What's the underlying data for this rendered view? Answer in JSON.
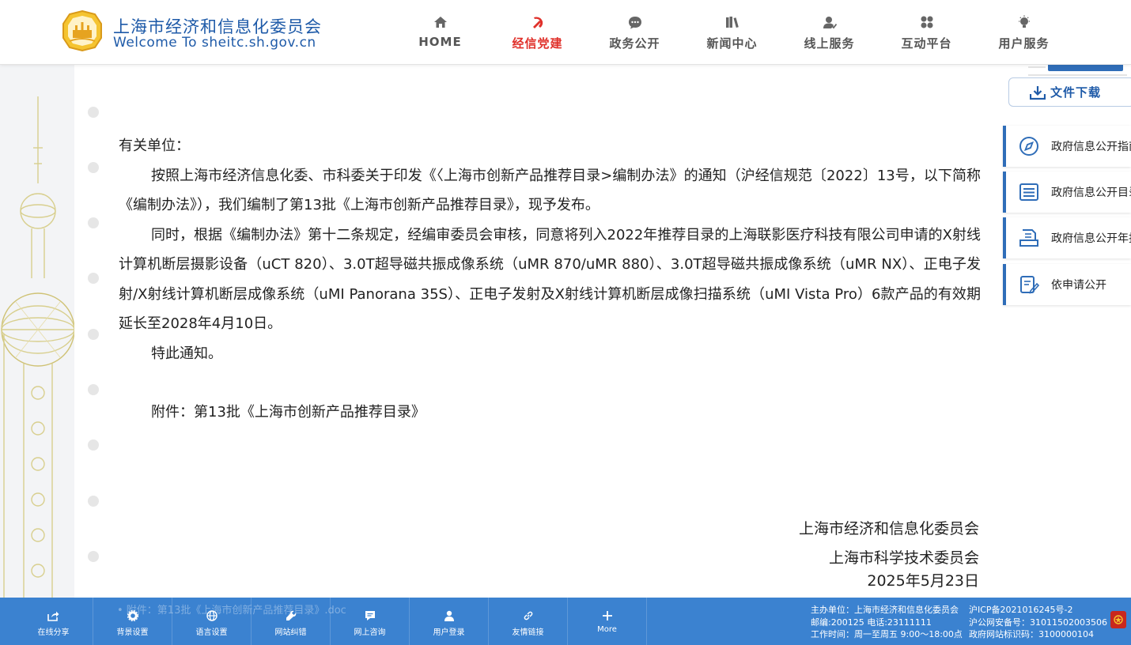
{
  "header": {
    "site_name_cn": "上海市经济和信息化委员会",
    "site_name_en": "Welcome To sheitc.sh.gov.cn",
    "nav": [
      {
        "label": "HOME",
        "icon": "home-icon",
        "active": false
      },
      {
        "label": "经信党建",
        "icon": "party-emblem-icon",
        "active": true
      },
      {
        "label": "政务公开",
        "icon": "chat-bubble-icon",
        "active": false
      },
      {
        "label": "新闻中心",
        "icon": "books-icon",
        "active": false
      },
      {
        "label": "线上服务",
        "icon": "user-service-icon",
        "active": false
      },
      {
        "label": "互动平台",
        "icon": "interaction-icon",
        "active": false
      },
      {
        "label": "用户服务",
        "icon": "lightbulb-icon",
        "active": false
      }
    ]
  },
  "article": {
    "salutation": "有关单位：",
    "paragraphs": [
      "按照上海市经济信息化委、市科委关于印发《〈上海市创新产品推荐目录>编制办法》的通知（沪经信规范〔2022〕13号，以下简称《编制办法》），我们编制了第13批《上海市创新产品推荐目录》，现予发布。",
      "同时，根据《编制办法》第十二条规定，经编审委员会审核，同意将列入2022年推荐目录的上海联影医疗科技有限公司申请的X射线计算机断层摄影设备（uCT 820）、3.0T超导磁共振成像系统（uMR 870/uMR 880）、3.0T超导磁共振成像系统（uMR NX）、正电子发射/X射线计算机断层成像系统（uMI Panorana 35S）、正电子发射及X射线计算机断层成像扫描系统（uMI Vista Pro）6款产品的有效期延长至2028年4月10日。",
      "特此通知。"
    ],
    "attachment": "附件：第13批《上海市创新产品推荐目录》",
    "signatures": [
      "上海市经济和信息化委员会",
      "上海市科学技术委员会"
    ],
    "date": "2025年5月23日"
  },
  "sidebar": {
    "download_label": "文件下载",
    "links": [
      {
        "label": "政府信息公开指南",
        "icon": "compass-icon"
      },
      {
        "label": "政府信息公开目录",
        "icon": "list-icon"
      },
      {
        "label": "政府信息公开年报",
        "icon": "report-icon"
      },
      {
        "label": "依申请公开",
        "icon": "apply-form-icon"
      }
    ]
  },
  "footer": {
    "tools": [
      {
        "label": "在线分享",
        "icon": "share-icon"
      },
      {
        "label": "背景设置",
        "icon": "gear-icon"
      },
      {
        "label": "语言设置",
        "icon": "globe-icon"
      },
      {
        "label": "网站纠错",
        "icon": "wrench-icon"
      },
      {
        "label": "网上咨询",
        "icon": "message-icon"
      },
      {
        "label": "用户登录",
        "icon": "user-icon"
      },
      {
        "label": "友情链接",
        "icon": "link-icon"
      },
      {
        "label": "More",
        "icon": "plus-icon"
      }
    ],
    "ghost_attachment": "• 附件：第13批《上海市创新产品推荐目录》.doc",
    "info_left": [
      "主办单位：上海市经济和信息化委员会",
      "邮编:200125 电话:23111111",
      "工作时间：周一至周五 9:00～18:00点"
    ],
    "info_right": [
      "沪ICP备2021016245号-2",
      "沪公网安备号：31011502003506",
      "政府网站标识码：3100000104"
    ]
  },
  "colors": {
    "brand_blue": "#1e5aa8",
    "active_red": "#e0312b",
    "footer_blue": "#3b82d0"
  }
}
